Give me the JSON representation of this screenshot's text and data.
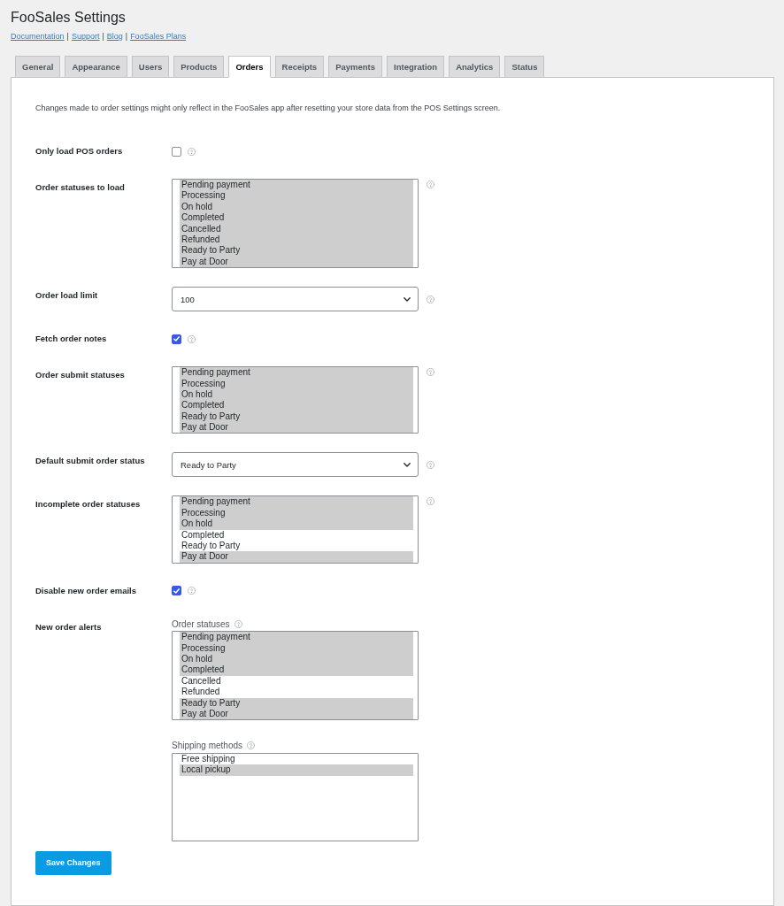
{
  "header": {
    "title": "FooSales Settings",
    "links": [
      "Documentation",
      "Support",
      "Blog",
      "FooSales Plans"
    ],
    "link_separator": "|"
  },
  "tabs": [
    {
      "label": "General",
      "selected": false
    },
    {
      "label": "Appearance",
      "selected": false
    },
    {
      "label": "Users",
      "selected": false
    },
    {
      "label": "Products",
      "selected": false
    },
    {
      "label": "Orders",
      "selected": true
    },
    {
      "label": "Receipts",
      "selected": false
    },
    {
      "label": "Payments",
      "selected": false
    },
    {
      "label": "Integration",
      "selected": false
    },
    {
      "label": "Analytics",
      "selected": false
    },
    {
      "label": "Status",
      "selected": false
    }
  ],
  "intro": "Changes made to order settings might only reflect in the FooSales app after resetting your store data from the POS Settings screen.",
  "settings": [
    {
      "kind": "checkbox",
      "label": "Only load POS orders",
      "checked": false
    },
    {
      "kind": "multiselect",
      "label": "Order statuses to load",
      "options": [
        {
          "label": "Pending payment",
          "selected": true
        },
        {
          "label": "Processing",
          "selected": true
        },
        {
          "label": "On hold",
          "selected": true
        },
        {
          "label": "Completed",
          "selected": true
        },
        {
          "label": "Cancelled",
          "selected": true
        },
        {
          "label": "Refunded",
          "selected": true
        },
        {
          "label": "Ready to Party",
          "selected": true
        },
        {
          "label": "Pay at Door",
          "selected": true
        }
      ]
    },
    {
      "kind": "select",
      "label": "Order load limit",
      "value": "100"
    },
    {
      "kind": "checkbox",
      "label": "Fetch order notes",
      "checked": true
    },
    {
      "kind": "multiselect",
      "label": "Order submit statuses",
      "options": [
        {
          "label": "Pending payment",
          "selected": true
        },
        {
          "label": "Processing",
          "selected": true
        },
        {
          "label": "On hold",
          "selected": true
        },
        {
          "label": "Completed",
          "selected": true
        },
        {
          "label": "Ready to Party",
          "selected": true
        },
        {
          "label": "Pay at Door",
          "selected": true
        }
      ]
    },
    {
      "kind": "select",
      "label": "Default submit order status",
      "value": "Ready to Party"
    },
    {
      "kind": "multiselect",
      "label": "Incomplete order statuses",
      "options": [
        {
          "label": "Pending payment",
          "selected": true
        },
        {
          "label": "Processing",
          "selected": true
        },
        {
          "label": "On hold",
          "selected": true
        },
        {
          "label": "Completed",
          "selected": false
        },
        {
          "label": "Ready to Party",
          "selected": false
        },
        {
          "label": "Pay at Door",
          "selected": true
        }
      ]
    },
    {
      "kind": "checkbox",
      "label": "Disable new order emails",
      "checked": true
    },
    {
      "kind": "group",
      "label": "New order alerts",
      "fields": [
        {
          "label": "Order statuses",
          "options": [
            {
              "label": "Pending payment",
              "selected": true
            },
            {
              "label": "Processing",
              "selected": true
            },
            {
              "label": "On hold",
              "selected": true
            },
            {
              "label": "Completed",
              "selected": true
            },
            {
              "label": "Cancelled",
              "selected": false
            },
            {
              "label": "Refunded",
              "selected": false
            },
            {
              "label": "Ready to Party",
              "selected": true
            },
            {
              "label": "Pay at Door",
              "selected": true
            }
          ]
        },
        {
          "label": "Shipping methods",
          "options": [
            {
              "label": "Free shipping",
              "selected": false
            },
            {
              "label": "Local pickup",
              "selected": true
            }
          ]
        }
      ]
    }
  ],
  "save_button": "Save Changes"
}
